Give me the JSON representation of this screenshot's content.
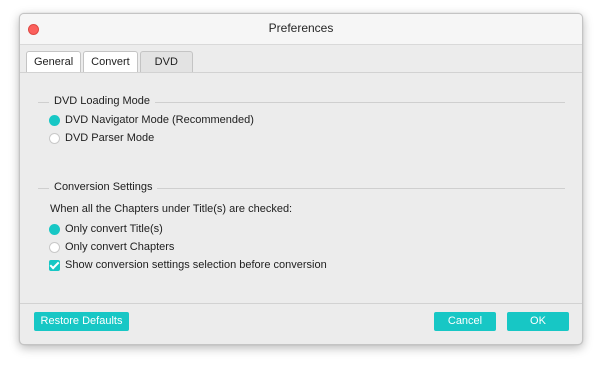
{
  "window": {
    "title": "Preferences"
  },
  "tabs": [
    {
      "label": "General"
    },
    {
      "label": "Convert"
    },
    {
      "label": "DVD"
    }
  ],
  "dvd_loading": {
    "title": "DVD Loading Mode",
    "options": [
      {
        "label": "DVD Navigator Mode (Recommended)",
        "selected": true
      },
      {
        "label": "DVD Parser Mode",
        "selected": false
      }
    ]
  },
  "conversion": {
    "title": "Conversion Settings",
    "prompt": "When all the Chapters under Title(s) are checked:",
    "options": [
      {
        "label": "Only convert Title(s)",
        "selected": true
      },
      {
        "label": "Only convert Chapters",
        "selected": false
      }
    ],
    "checkbox": {
      "label": "Show conversion settings selection before conversion",
      "checked": true
    }
  },
  "footer": {
    "restore_label": "Restore Defaults",
    "cancel_label": "Cancel",
    "ok_label": "OK"
  },
  "colors": {
    "accent": "#17c7c5",
    "close": "#fc605c"
  }
}
